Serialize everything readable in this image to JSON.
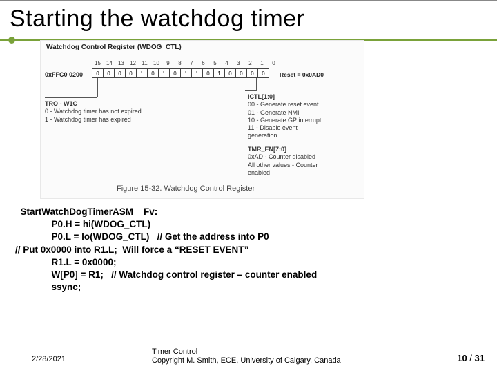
{
  "title": "Starting the watchdog timer",
  "diagram": {
    "heading": "Watchdog Control Register (WDOG_CTL)",
    "address": "0xFFC0 0200",
    "bits": [
      "15",
      "14",
      "13",
      "12",
      "11",
      "10",
      "9",
      "8",
      "7",
      "6",
      "5",
      "4",
      "3",
      "2",
      "1",
      "0"
    ],
    "reset_groups": [
      "0",
      "0 0 0",
      "1 0",
      "1 0",
      "1 1 0 1",
      "0 0",
      "0 0"
    ],
    "reset_label": "Reset = 0x0AD0",
    "tro": {
      "title": "TRO - W1C",
      "l1": "0 - Watchdog timer has not expired",
      "l2": "1 - Watchdog timer has expired"
    },
    "ictl": {
      "title": "ICTL[1:0]",
      "l1": "00 - Generate reset event",
      "l2": "01 - Generate NMI",
      "l3": "10 - Generate GP interrupt",
      "l4": "11 - Disable event",
      "l5": "generation"
    },
    "tmren": {
      "title": "TMR_EN[7:0]",
      "l1": "0xAD - Counter disabled",
      "l2": "All other values - Counter",
      "l3": "enabled"
    },
    "caption": "Figure 15-32. Watchdog Control Register"
  },
  "code": {
    "label": "_StartWatchDogTimerASM__Fv:",
    "l1": "              P0.H = hi(WDOG_CTL)",
    "l2": "              P0.L = lo(WDOG_CTL)   // Get the address into P0",
    "l3a": "// Put 0x0000 into R1.L;  Will force a ",
    "l3b": "RESET EVENT",
    "l4": "              R1.L = 0x0000;",
    "l5": "              W[P0] = R1;   // Watchdog control register – counter enabled",
    "l6": "              ssync;"
  },
  "footer": {
    "date": "2/28/2021",
    "mid_l1": "Timer Control",
    "mid_l2": "Copyright M. Smith, ECE, University of Calgary, Canada",
    "page_cur": "10",
    "page_sep": " / ",
    "page_tot": "31"
  }
}
